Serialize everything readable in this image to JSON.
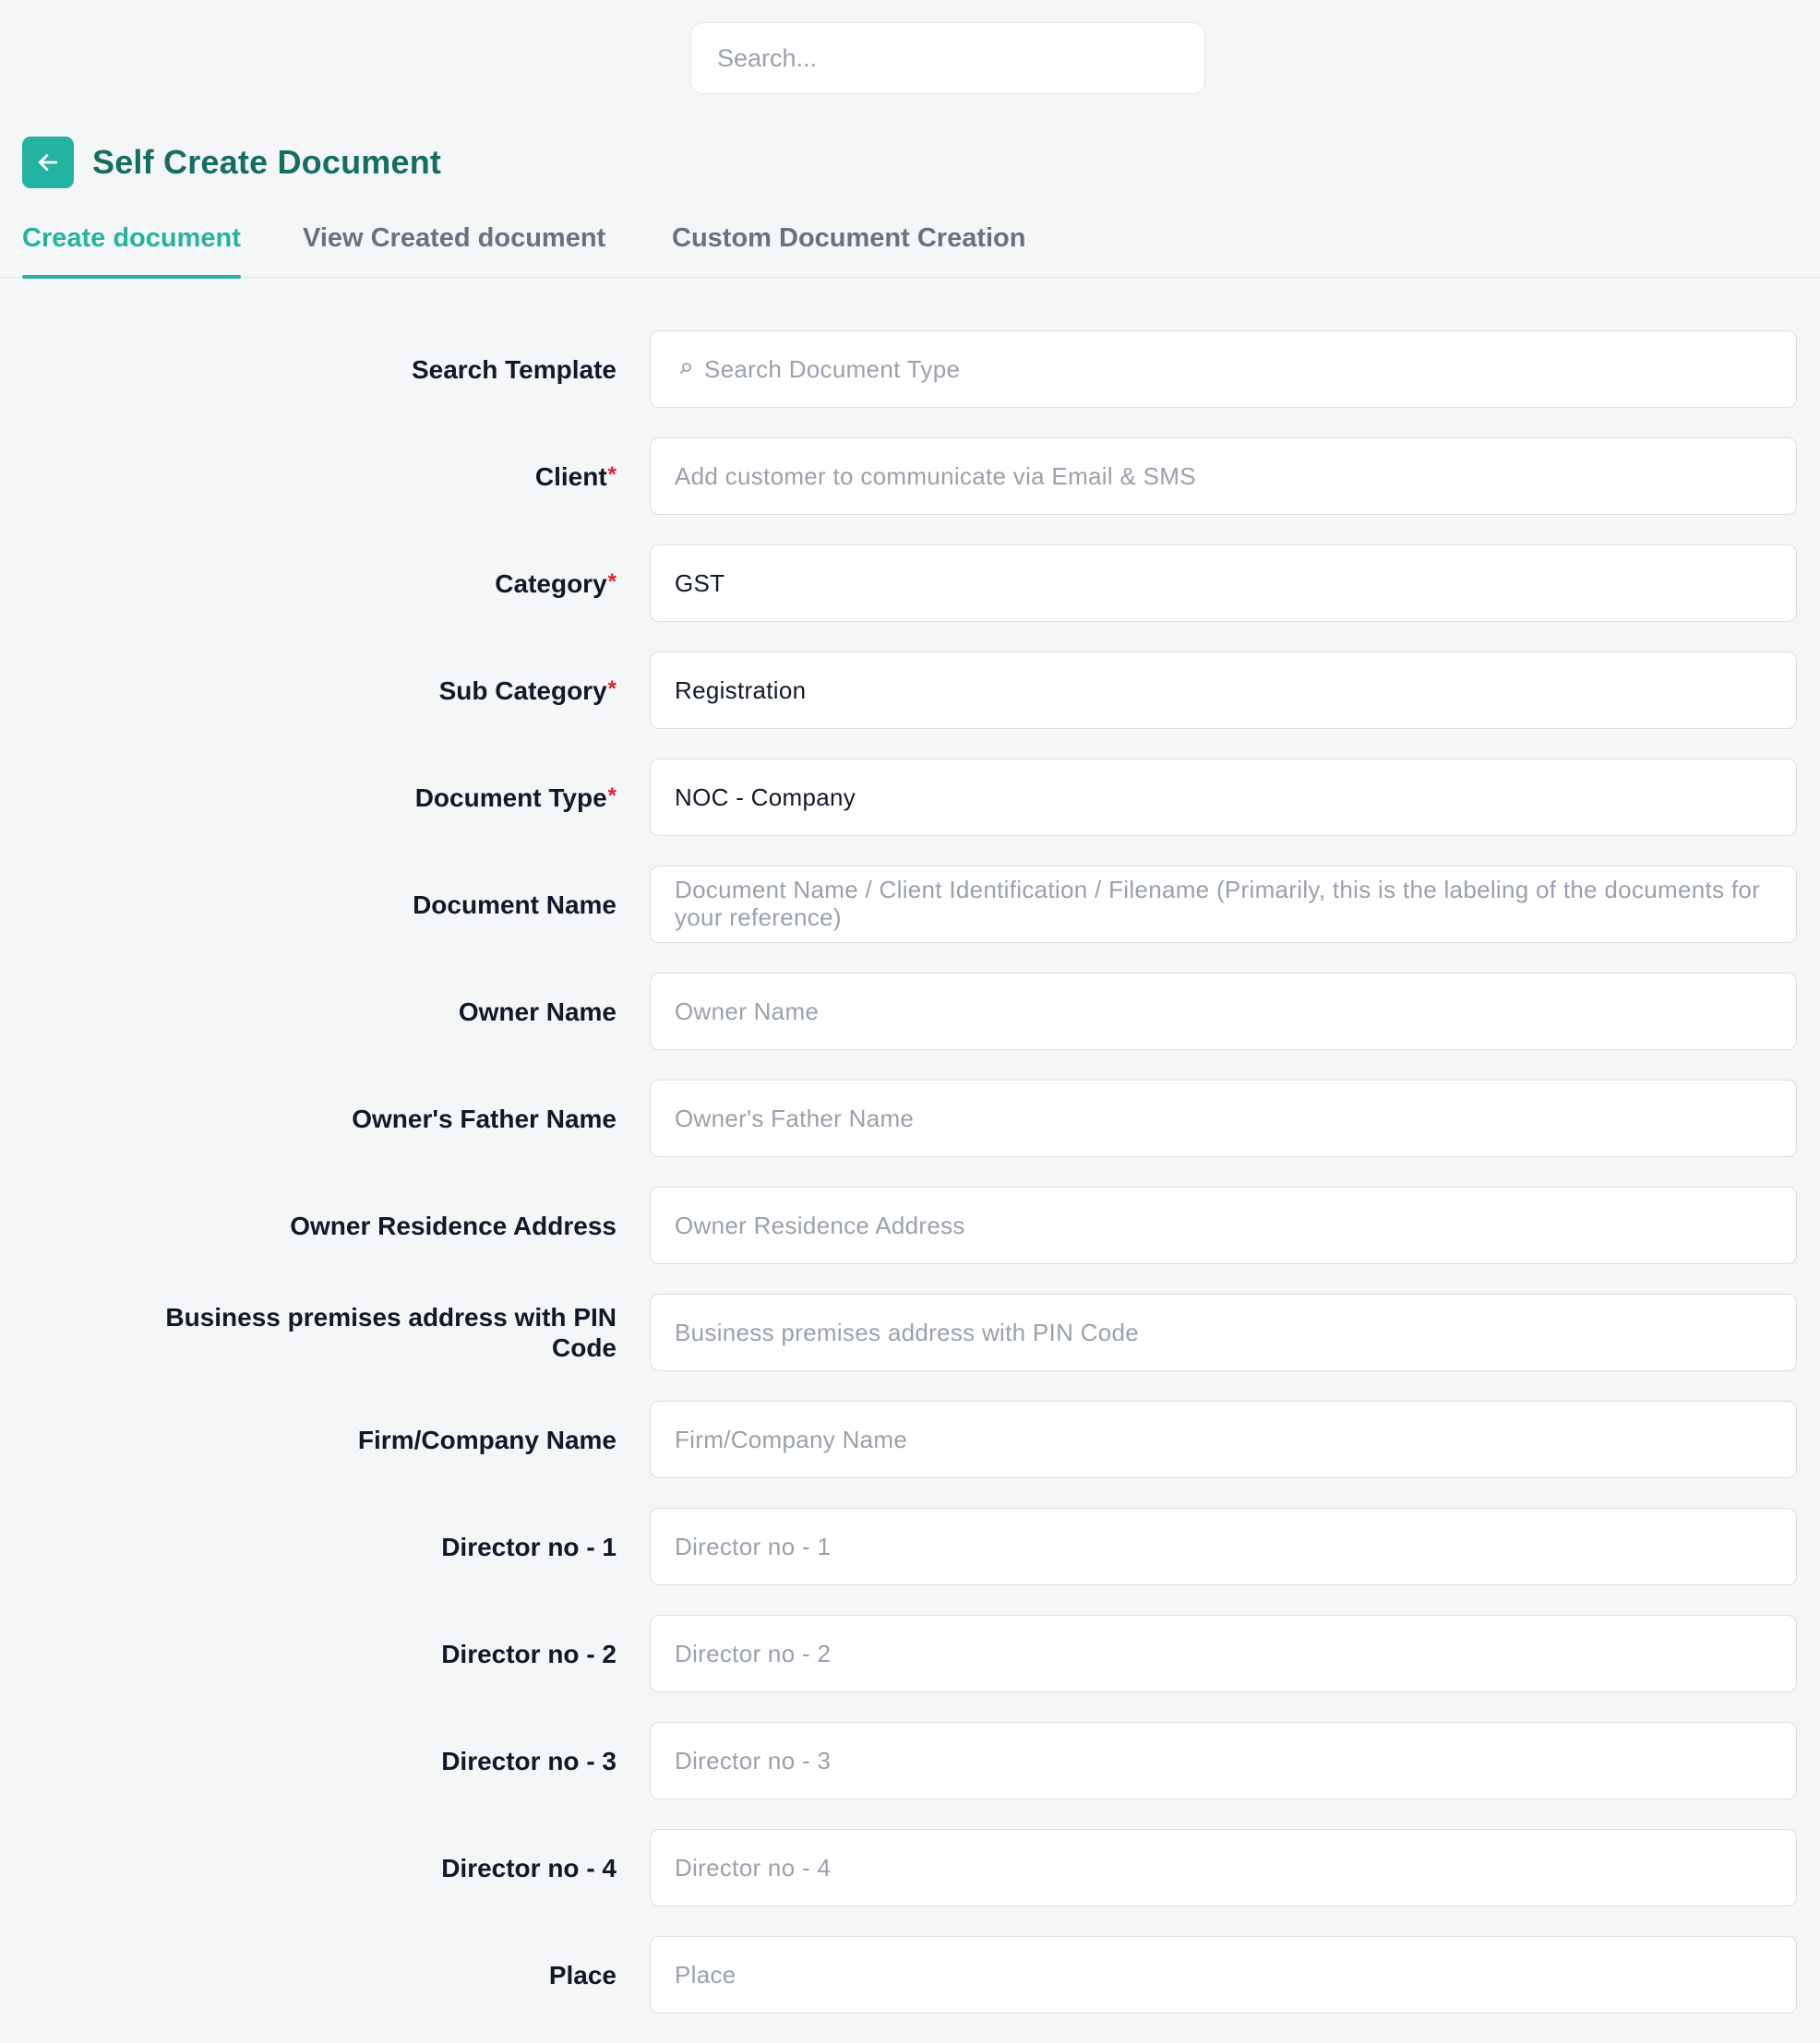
{
  "top_search": {
    "placeholder": "Search..."
  },
  "header": {
    "title": "Self Create Document"
  },
  "tabs": [
    {
      "label": "Create document",
      "active": true
    },
    {
      "label": "View Created document",
      "active": false
    },
    {
      "label": "Custom Document Creation",
      "active": false
    }
  ],
  "colors": {
    "accent": "#24b3a0",
    "title": "#156e62",
    "required": "#e02424"
  },
  "form": {
    "required_mark": "*",
    "search_template": {
      "label": "Search Template",
      "placeholder": "Search Document Type"
    },
    "client": {
      "label": "Client",
      "placeholder": "Add customer to communicate via Email & SMS"
    },
    "category": {
      "label": "Category",
      "value": "GST"
    },
    "sub_category": {
      "label": "Sub Category",
      "value": "Registration"
    },
    "document_type": {
      "label": "Document Type",
      "value": "NOC - Company"
    },
    "document_name": {
      "label": "Document Name",
      "placeholder": "Document Name / Client Identification / Filename (Primarily, this is the labeling of the documents for your reference)"
    },
    "owner_name": {
      "label": "Owner Name",
      "placeholder": "Owner Name"
    },
    "owner_father_name": {
      "label": "Owner's Father Name",
      "placeholder": "Owner's Father Name"
    },
    "owner_residence_address": {
      "label": "Owner Residence Address",
      "placeholder": "Owner Residence Address"
    },
    "business_address": {
      "label": "Business premises address with PIN Code",
      "placeholder": "Business premises address with PIN Code"
    },
    "firm_name": {
      "label": "Firm/Company Name",
      "placeholder": "Firm/Company Name"
    },
    "director_1": {
      "label": "Director no - 1",
      "placeholder": "Director no - 1"
    },
    "director_2": {
      "label": "Director no - 2",
      "placeholder": "Director no - 2"
    },
    "director_3": {
      "label": "Director no - 3",
      "placeholder": "Director no - 3"
    },
    "director_4": {
      "label": "Director no - 4",
      "placeholder": "Director no - 4"
    },
    "place": {
      "label": "Place",
      "placeholder": "Place"
    }
  }
}
